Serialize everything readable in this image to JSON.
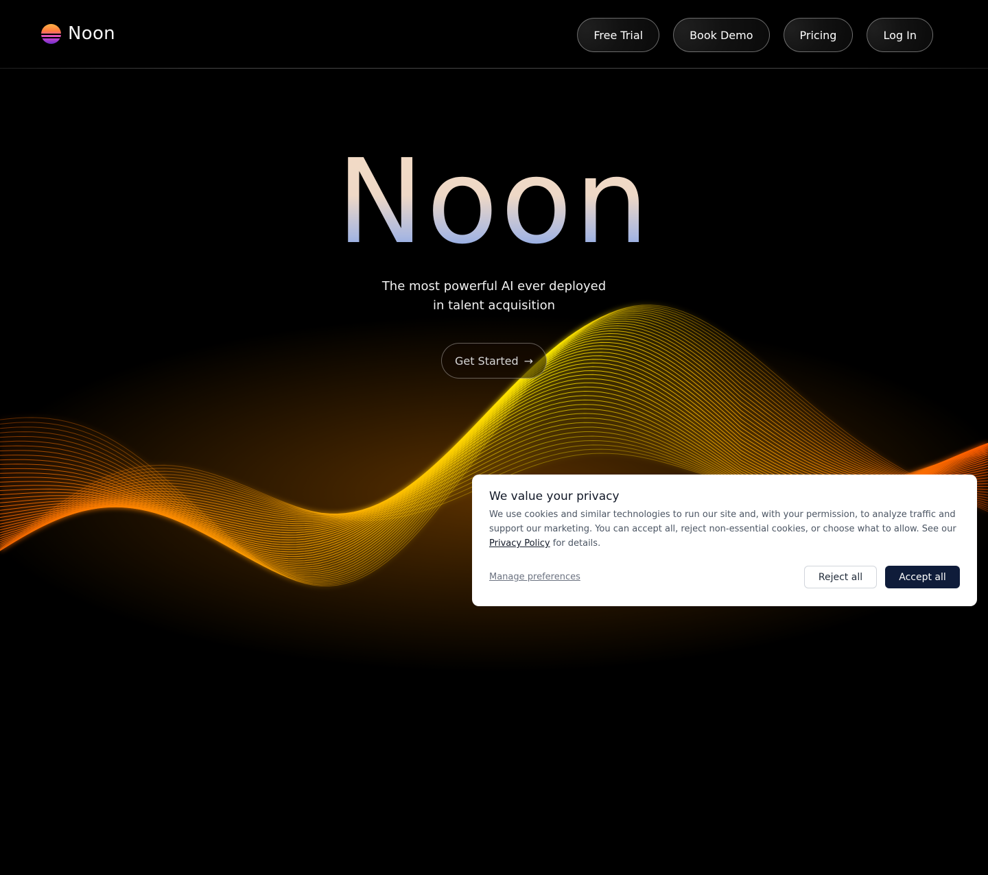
{
  "brand": {
    "name": "Noon"
  },
  "nav": {
    "items": [
      {
        "label": "Free Trial"
      },
      {
        "label": "Book Demo"
      },
      {
        "label": "Pricing"
      },
      {
        "label": "Log In"
      }
    ]
  },
  "hero": {
    "title": "Noon",
    "subtitle_line1": "The most powerful AI ever deployed",
    "subtitle_line2": "in talent acquisition",
    "cta_label": "Get Started",
    "cta_icon": "arrow-right-icon"
  },
  "cookie_banner": {
    "title": "We value your privacy",
    "body": "We use cookies and similar technologies to run our site and, with your permission, to analyze traffic and support our marketing. You can accept all, reject non-essential cookies, or choose what to allow. See our",
    "privacy_link": "Privacy Policy",
    "body_suffix": "for details.",
    "manage_label": "Manage preferences",
    "reject_label": "Reject all",
    "accept_label": "Accept all"
  },
  "colors": {
    "background": "#000000",
    "accent_button": "#0f1c3a",
    "wave_orange": "#ff7a1a",
    "wave_yellow": "#ffe600"
  }
}
